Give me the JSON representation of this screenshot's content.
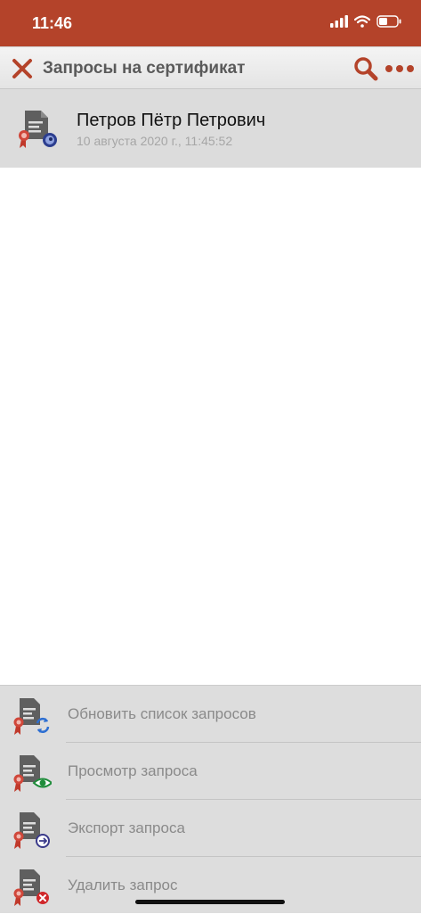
{
  "status_bar": {
    "time": "11:46",
    "icons": [
      "signal-icon",
      "wifi-icon",
      "battery-icon"
    ]
  },
  "toolbar": {
    "title": "Запросы на сертификат",
    "close_icon": "close-icon",
    "search_icon": "search-icon",
    "more_icon": "more-icon"
  },
  "requests": [
    {
      "name": "Петров Пётр Петрович",
      "date": "10 августа 2020 г., 11:45:52",
      "icon": "certificate-request-icon"
    }
  ],
  "action_menu": {
    "items": [
      {
        "label": "Обновить список запросов",
        "icon": "refresh-requests-icon"
      },
      {
        "label": "Просмотр запроса",
        "icon": "view-request-icon"
      },
      {
        "label": "Экспорт запроса",
        "icon": "export-request-icon"
      },
      {
        "label": "Удалить запрос",
        "icon": "delete-request-icon"
      }
    ]
  },
  "colors": {
    "accent": "#b4432a",
    "item_bg": "#dcdcdc",
    "menu_bg": "#dddddd",
    "muted_text": "#8a8a8a"
  }
}
